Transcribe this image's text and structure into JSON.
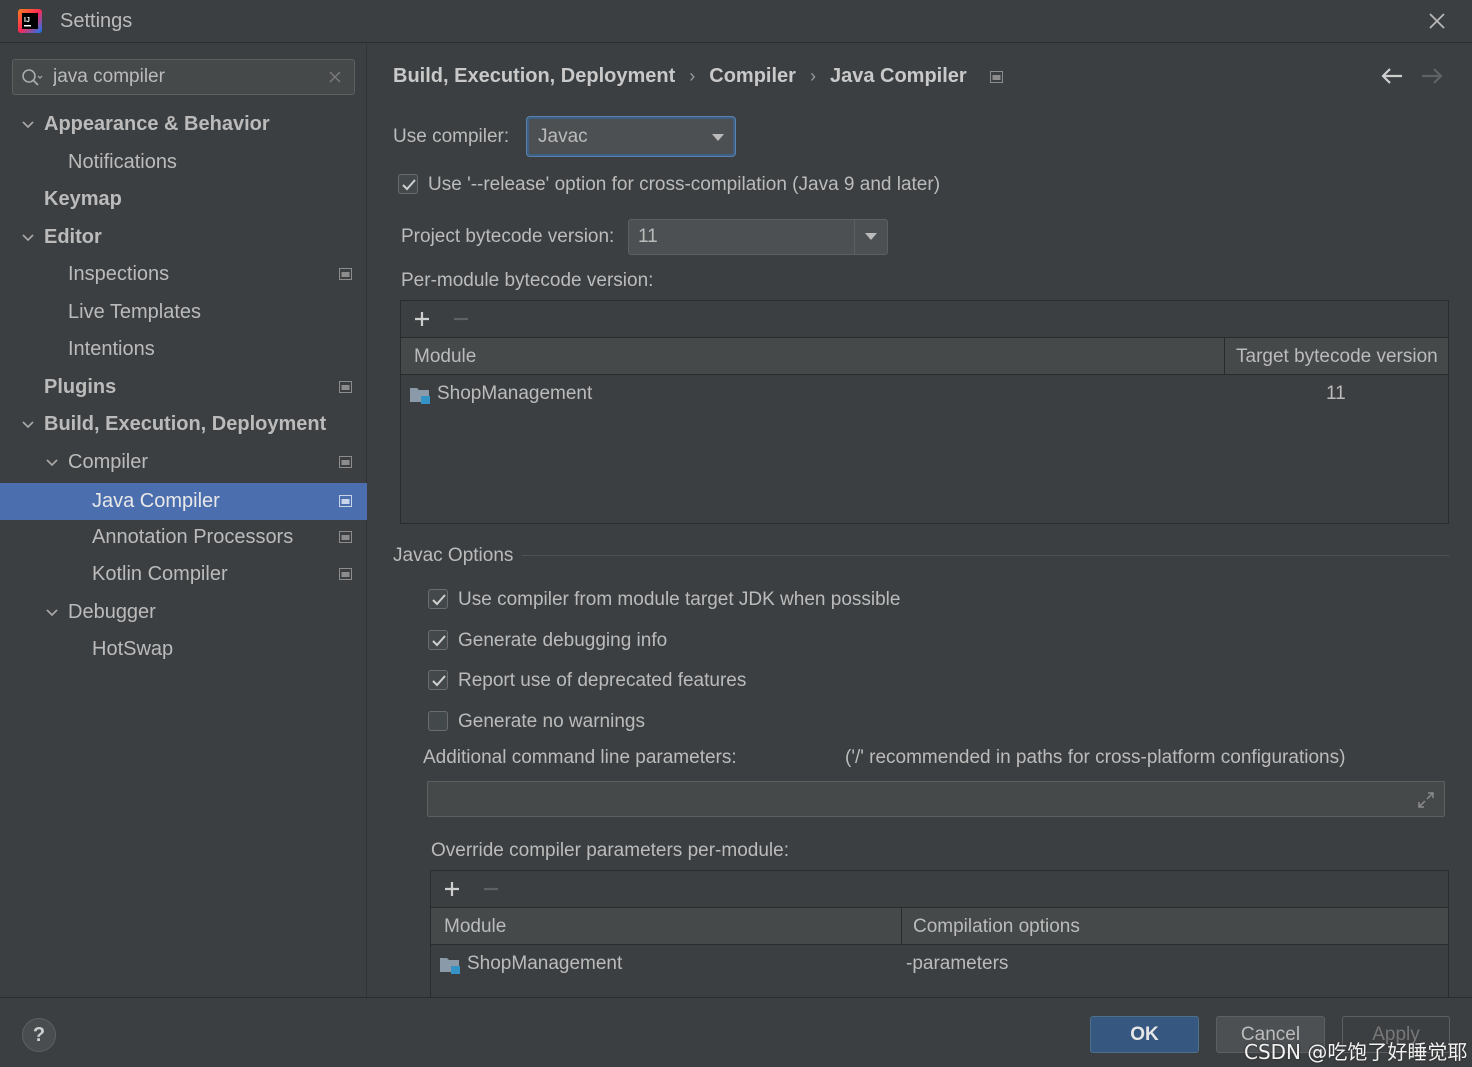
{
  "window": {
    "title": "Settings"
  },
  "search": {
    "value": "java compiler",
    "placeholder": ""
  },
  "sidebar": {
    "items": [
      {
        "label": "Appearance & Behavior"
      },
      {
        "label": "Notifications"
      },
      {
        "label": "Keymap"
      },
      {
        "label": "Editor"
      },
      {
        "label": "Inspections"
      },
      {
        "label": "Live Templates"
      },
      {
        "label": "Intentions"
      },
      {
        "label": "Plugins"
      },
      {
        "label": "Build, Execution, Deployment"
      },
      {
        "label": "Compiler"
      },
      {
        "label": "Java Compiler"
      },
      {
        "label": "Annotation Processors"
      },
      {
        "label": "Kotlin Compiler"
      },
      {
        "label": "Debugger"
      },
      {
        "label": "HotSwap"
      }
    ],
    "selected": "Java Compiler"
  },
  "breadcrumb": {
    "items": [
      "Build, Execution, Deployment",
      "Compiler",
      "Java Compiler"
    ],
    "separator": "›"
  },
  "compiler": {
    "use_compiler_label": "Use compiler:",
    "use_compiler_value": "Javac",
    "release_option_label": "Use '--release' option for cross-compilation (Java 9 and later)",
    "release_option_checked": true,
    "bytecode_label": "Project bytecode version:",
    "bytecode_value": "11",
    "per_module_label": "Per-module bytecode version:"
  },
  "per_module_table": {
    "columns": [
      "Module",
      "Target bytecode version"
    ],
    "rows": [
      {
        "module": "ShopManagement",
        "version": "11"
      }
    ]
  },
  "javac": {
    "section_title": "Javac Options",
    "options": [
      {
        "label": "Use compiler from module target JDK when possible",
        "checked": true
      },
      {
        "label": "Generate debugging info",
        "checked": true
      },
      {
        "label": "Report use of deprecated features",
        "checked": true
      },
      {
        "label": "Generate no warnings",
        "checked": false
      }
    ],
    "additional_params_label": "Additional command line parameters:",
    "additional_params_hint": "('/' recommended in paths for cross-platform configurations)",
    "additional_params_value": "",
    "override_label": "Override compiler parameters per-module:"
  },
  "override_table": {
    "columns": [
      "Module",
      "Compilation options"
    ],
    "rows": [
      {
        "module": "ShopManagement",
        "options": "-parameters"
      }
    ]
  },
  "footer": {
    "help": "?",
    "ok": "OK",
    "cancel": "Cancel",
    "apply": "Apply",
    "watermark": "CSDN @吃饱了好睡觉耶"
  },
  "colors": {
    "background": "#3c3f41",
    "selection": "#4b6eaf",
    "ok_button": "#365880",
    "text": "#bbbbbb"
  },
  "icons": [
    "intellij-icon",
    "close-icon",
    "search-icon",
    "clear-icon",
    "chevron-down-icon",
    "project-level-icon",
    "back-arrow-icon",
    "forward-arrow-icon",
    "dropdown-arrow-icon",
    "check-icon",
    "plus-icon",
    "minus-icon",
    "module-folder-icon",
    "expand-icon"
  ]
}
